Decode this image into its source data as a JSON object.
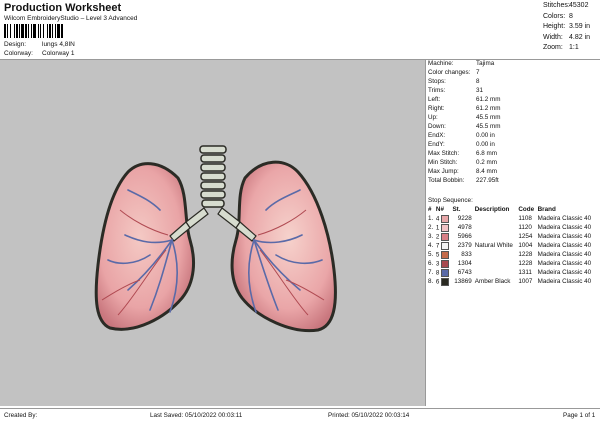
{
  "header": {
    "title": "Production Worksheet",
    "subtitle": "Wilcom EmbroideryStudio – Level 3 Advanced",
    "design_label": "Design:",
    "design_value": "lungs 4,8IN",
    "colorway_label": "Colorway:",
    "colorway_value": "Colorway 1"
  },
  "summary": [
    {
      "label": "Stitches:",
      "value": "45302"
    },
    {
      "label": "Colors:",
      "value": "8"
    },
    {
      "label": "Height:",
      "value": "3.59 in"
    },
    {
      "label": "Width:",
      "value": "4.82 in"
    },
    {
      "label": "Zoom:",
      "value": "1:1"
    }
  ],
  "info": [
    {
      "label": "Machine:",
      "value": "Tajima"
    },
    {
      "label": "Color changes:",
      "value": "7"
    },
    {
      "label": "Stops:",
      "value": "8"
    },
    {
      "label": "Trims:",
      "value": "31"
    },
    {
      "label": "Left:",
      "value": "61.2 mm"
    },
    {
      "label": "Right:",
      "value": "61.2 mm"
    },
    {
      "label": "Up:",
      "value": "45.5 mm"
    },
    {
      "label": "Down:",
      "value": "45.5 mm"
    },
    {
      "label": "EndX:",
      "value": "0.00 in"
    },
    {
      "label": "EndY:",
      "value": "0.00 in"
    },
    {
      "label": "Max Stitch:",
      "value": "6.8 mm"
    },
    {
      "label": "Min Stitch:",
      "value": "0.2 mm"
    },
    {
      "label": "Max Jump:",
      "value": "8.4 mm"
    },
    {
      "label": "Total Bobbin:",
      "value": "227.95ft"
    }
  ],
  "stop_sequence": {
    "title": "Stop Sequence:",
    "columns": [
      "#",
      "N#",
      "St.",
      "Description",
      "Code",
      "Brand"
    ],
    "rows": [
      {
        "num": "1.",
        "n": "4",
        "color": "#e8a7a9",
        "st": "9228",
        "desc": "",
        "code": "1108",
        "brand": "Madeira Classic 40"
      },
      {
        "num": "2.",
        "n": "1",
        "color": "#f2c3c6",
        "st": "4978",
        "desc": "",
        "code": "1120",
        "brand": "Madeira Classic 40"
      },
      {
        "num": "3.",
        "n": "2",
        "color": "#d97f86",
        "st": "5966",
        "desc": "",
        "code": "1254",
        "brand": "Madeira Classic 40"
      },
      {
        "num": "4.",
        "n": "7",
        "color": "#f4f4f4",
        "st": "2379",
        "desc": "Natural White",
        "code": "1004",
        "brand": "Madeira Classic 40"
      },
      {
        "num": "5.",
        "n": "5",
        "color": "#c46a4a",
        "st": "833",
        "desc": "",
        "code": "1228",
        "brand": "Madeira Classic 40"
      },
      {
        "num": "6.",
        "n": "3",
        "color": "#a84a4f",
        "st": "1304",
        "desc": "",
        "code": "1228",
        "brand": "Madeira Classic 40"
      },
      {
        "num": "7.",
        "n": "8",
        "color": "#5a6aa8",
        "st": "6743",
        "desc": "",
        "code": "1311",
        "brand": "Madeira Classic 40"
      },
      {
        "num": "8.",
        "n": "6",
        "color": "#2a2a22",
        "st": "13869",
        "desc": "Amber Black",
        "code": "1007",
        "brand": "Madeira Classic 40"
      }
    ]
  },
  "footer": {
    "created_by": "Created By:",
    "last_saved": "Last Saved: 05/10/2022 00:03:11",
    "printed": "Printed: 05/10/2022 00:03:14",
    "page": "Page 1 of 1"
  }
}
